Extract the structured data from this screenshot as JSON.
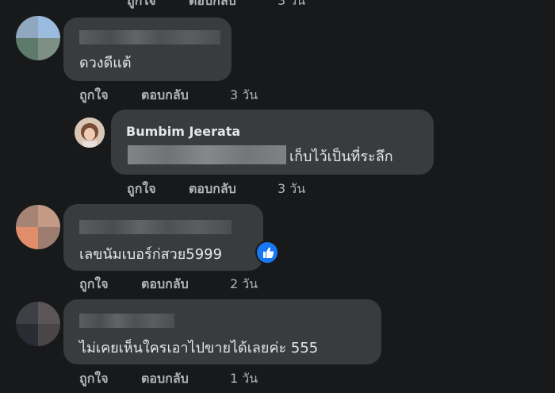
{
  "top_partial": {
    "like": "ถูกใจ",
    "reply": "ตอบกลับ",
    "time": "3 วัน"
  },
  "comments": [
    {
      "name_blurred": true,
      "text": "ดวงดีแต้",
      "like": "ถูกใจ",
      "reply": "ตอบกลับ",
      "time": "3 วัน"
    },
    {
      "name": "Bumbim Jeerata",
      "text_suffix": "เก็บไว้เป็นที่ระลึก",
      "like": "ถูกใจ",
      "reply": "ตอบกลับ",
      "time": "3 วัน"
    },
    {
      "name_blurred": true,
      "text": "เลขนัมเบอร์ก่สวย5999",
      "reaction": "like-icon",
      "like": "ถูกใจ",
      "reply": "ตอบกลับ",
      "time": "2 วัน"
    },
    {
      "name_blurred": true,
      "text": "ไม่เคยเห็นใครเอาไปขายได้เลยค่ะ 555",
      "like": "ถูกใจ",
      "reply": "ตอบกลับ",
      "time": "1 วัน"
    }
  ],
  "colors": {
    "background": "#18191a",
    "bubble": "#3a3b3c",
    "text": "#e4e6eb",
    "secondary": "#b0b3b8",
    "like_blue": "#1877f2"
  }
}
